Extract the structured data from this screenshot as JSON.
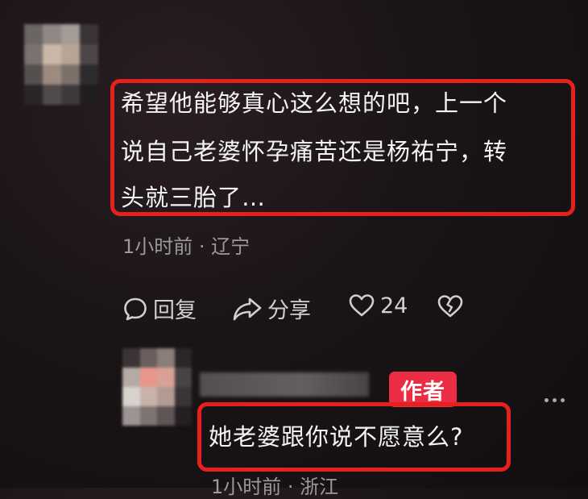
{
  "comment1": {
    "text_lines": [
      "希望他能够真心这么想的吧，上一个",
      "说自己老婆怀孕痛苦还是杨祐宁，转",
      "头就三胎了…"
    ],
    "meta": "1小时前 · 辽宁",
    "actions": {
      "reply_label": "回复",
      "share_label": "分享",
      "like_count": "24"
    }
  },
  "comment2": {
    "author_badge": "作者",
    "text": "她老婆跟你说不愿意么?",
    "meta": "1小时前 · 浙江"
  },
  "colors": {
    "highlight": "#e8201d",
    "badge": "#ea2c44"
  },
  "icons": [
    "reply-icon",
    "share-icon",
    "heart-icon",
    "dislike-heart-icon",
    "more-icon"
  ]
}
